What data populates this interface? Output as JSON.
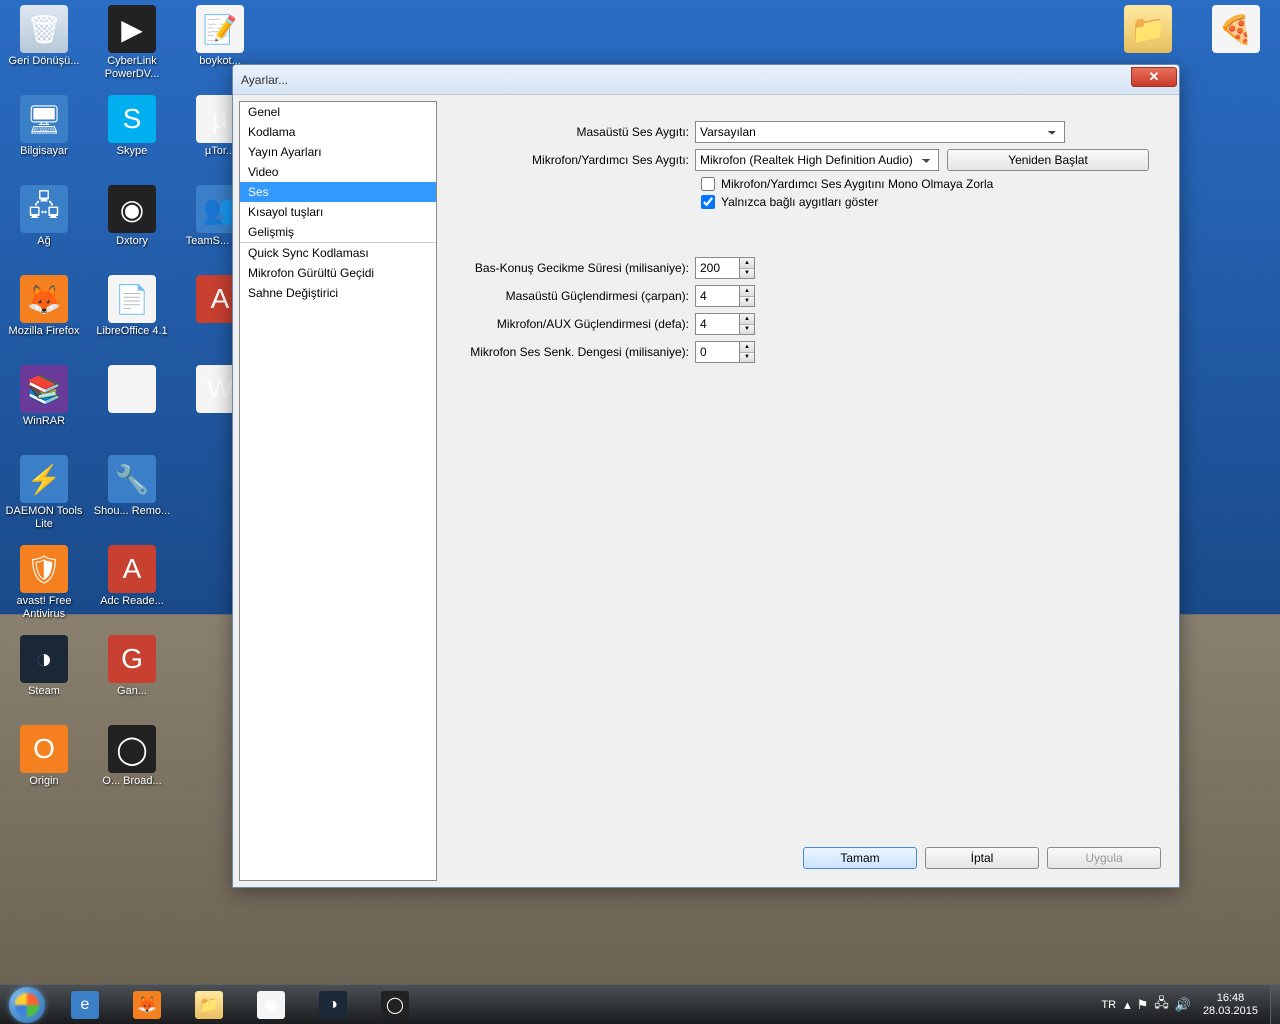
{
  "desktop_icons_left": [
    {
      "label": "Geri Dönüşü...",
      "cls": "recycle",
      "glyph": "🗑"
    },
    {
      "label": "Bilgisayar",
      "cls": "generic-blue",
      "glyph": "🖥"
    },
    {
      "label": "Ağ",
      "cls": "generic-blue",
      "glyph": "🖧"
    },
    {
      "label": "Mozilla Firefox",
      "cls": "generic-orange",
      "glyph": "🦊"
    },
    {
      "label": "WinRAR",
      "cls": "generic-purple",
      "glyph": "📚"
    },
    {
      "label": "DAEMON Tools Lite",
      "cls": "generic-blue",
      "glyph": "⚡"
    },
    {
      "label": "avast! Free Antivirus",
      "cls": "generic-orange",
      "glyph": "🛡"
    },
    {
      "label": "Steam",
      "cls": "steam",
      "glyph": "◑"
    },
    {
      "label": "Origin",
      "cls": "generic-orange",
      "glyph": "O"
    },
    {
      "label": "CyberLink PowerDV...",
      "cls": "generic-dark",
      "glyph": "▶"
    },
    {
      "label": "Skype",
      "cls": "generic-sky",
      "glyph": "S"
    },
    {
      "label": "Dxtory",
      "cls": "generic-dark",
      "glyph": "◉"
    },
    {
      "label": "LibreOffice 4.1",
      "cls": "generic-white",
      "glyph": "📄"
    },
    {
      "label": "",
      "cls": "generic-white",
      "glyph": ""
    },
    {
      "label": "Shou... Remo...",
      "cls": "generic-blue",
      "glyph": "🔧"
    },
    {
      "label": "Adc Reade...",
      "cls": "generic-red",
      "glyph": "A"
    },
    {
      "label": "Gan...",
      "cls": "generic-red",
      "glyph": "G"
    },
    {
      "label": "O... Broad...",
      "cls": "generic-dark",
      "glyph": "◯"
    },
    {
      "label": "boykot...",
      "cls": "generic-white",
      "glyph": "📝"
    },
    {
      "label": "µTor...",
      "cls": "generic-white",
      "glyph": "µ"
    },
    {
      "label": "TeamS... Cli...",
      "cls": "generic-blue",
      "glyph": "👥"
    },
    {
      "label": "",
      "cls": "generic-red",
      "glyph": "A"
    },
    {
      "label": "",
      "cls": "generic-white",
      "glyph": "W"
    }
  ],
  "desktop_icons_right": [
    {
      "label": "",
      "cls": "folder",
      "glyph": "📁"
    },
    {
      "label": "",
      "cls": "generic-white",
      "glyph": "🍕"
    }
  ],
  "window": {
    "title": "Ayarlar...",
    "sidebar": [
      "Genel",
      "Kodlama",
      "Yayın Ayarları",
      "Video",
      "Ses",
      "Kısayol tuşları",
      "Gelişmiş",
      "Quick Sync Kodlaması",
      "Mikrofon Gürültü Geçidi",
      "Sahne Değiştirici"
    ],
    "selected_index": 4,
    "sep_indices": [
      7
    ],
    "labels": {
      "desktop_device": "Masaüstü Ses Aygıtı:",
      "mic_device": "Mikrofon/Yardımcı Ses Aygıtı:",
      "restart": "Yeniden Başlat",
      "force_mono": "Mikrofon/Yardımcı Ses Aygıtını Mono Olmaya Zorla",
      "show_connected": "Yalnızca bağlı aygıtları göster",
      "ptt_delay": "Bas-Konuş Gecikme Süresi (milisaniye):",
      "desktop_boost": "Masaüstü Güçlendirmesi (çarpan):",
      "mic_boost": "Mikrofon/AUX Güçlendirmesi (defa):",
      "mic_sync": "Mikrofon Ses Senk. Dengesi (milisaniye):"
    },
    "values": {
      "desktop_device": "Varsayılan",
      "mic_device": "Mikrofon (Realtek High Definition Audio)",
      "force_mono": false,
      "show_connected": true,
      "ptt_delay": "200",
      "desktop_boost": "4",
      "mic_boost": "4",
      "mic_sync": "0"
    },
    "buttons": {
      "ok": "Tamam",
      "cancel": "İptal",
      "apply": "Uygula"
    }
  },
  "taskbar": {
    "apps": [
      {
        "name": "ie",
        "cls": "generic-blue",
        "glyph": "e"
      },
      {
        "name": "firefox",
        "cls": "generic-orange",
        "glyph": "🦊"
      },
      {
        "name": "explorer",
        "cls": "folder",
        "glyph": "📁"
      },
      {
        "name": "chrome",
        "cls": "generic-white",
        "glyph": "◉"
      },
      {
        "name": "steam",
        "cls": "steam",
        "glyph": "◑"
      },
      {
        "name": "obs",
        "cls": "generic-dark",
        "glyph": "◯"
      }
    ],
    "lang": "TR",
    "time": "16:48",
    "date": "28.03.2015"
  }
}
